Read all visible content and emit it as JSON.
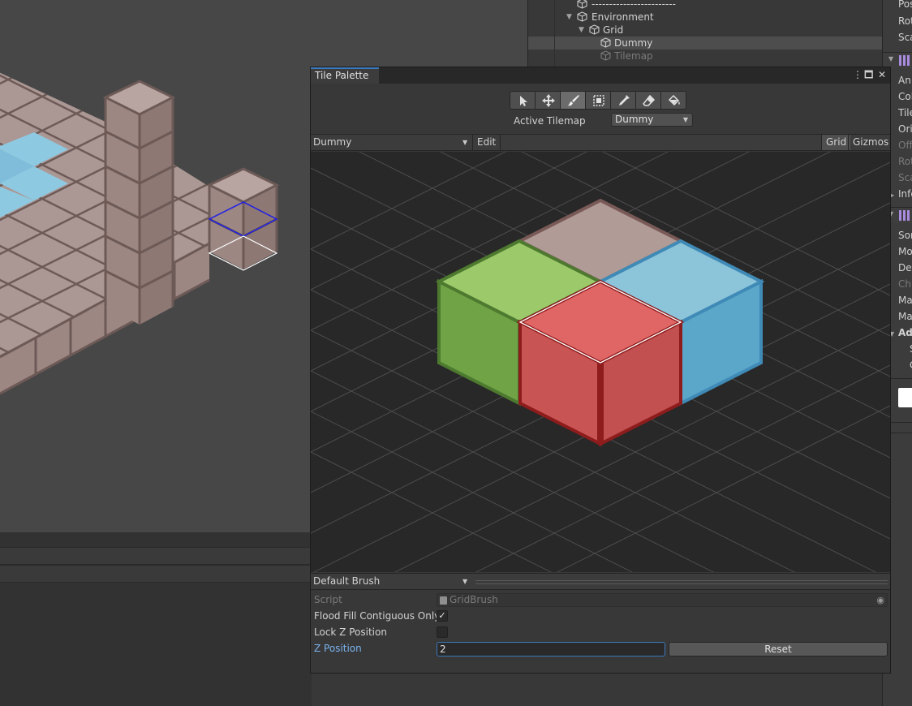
{
  "hierarchy": {
    "items": [
      {
        "label": "------------------------",
        "indent": 0,
        "state": "normal"
      },
      {
        "label": "Environment",
        "indent": 1,
        "state": "expanded"
      },
      {
        "label": "Grid",
        "indent": 2,
        "state": "expanded"
      },
      {
        "label": "Dummy",
        "indent": 3,
        "state": "selected"
      },
      {
        "label": "Tilemap",
        "indent": 3,
        "state": "dimmed"
      }
    ]
  },
  "inspector": {
    "labels": [
      "Pos",
      "Rot",
      "Sca",
      "Ani",
      "Col",
      "Tile",
      "Orie",
      "Off",
      "Rot",
      "Sca",
      "Info",
      "Sor",
      "Mo",
      "Det",
      "Chu",
      "Ma",
      "Ma",
      "Ad",
      "S",
      "C"
    ],
    "dimmed": [
      7,
      8,
      9,
      14
    ]
  },
  "tile_palette": {
    "tab_title": "Tile Palette",
    "tools": [
      {
        "name": "select-tool",
        "active": false
      },
      {
        "name": "move-tool",
        "active": false
      },
      {
        "name": "paint-tool",
        "active": true
      },
      {
        "name": "box-fill-tool",
        "active": false
      },
      {
        "name": "picker-tool",
        "active": false
      },
      {
        "name": "erase-tool",
        "active": false
      },
      {
        "name": "flood-fill-tool",
        "active": false
      }
    ],
    "active_tilemap_label": "Active Tilemap",
    "active_tilemap_value": "Dummy",
    "palette_select": "Dummy",
    "edit_label": "Edit",
    "grid_label": "Grid",
    "gizmos_label": "Gizmos",
    "brush_select": "Default Brush",
    "props": {
      "script_label": "Script",
      "script_value": "GridBrush",
      "flood_label": "Flood Fill Contiguous Only",
      "flood_checked": true,
      "lock_z_label": "Lock Z Position",
      "lock_z_checked": false,
      "z_label": "Z Position",
      "z_value": "2",
      "reset_label": "Reset"
    }
  },
  "colors": {
    "accent": "#3a79bb",
    "tile_gray": "#b09b97",
    "tile_green": "#9cca6b",
    "tile_blue": "#8cc5da",
    "tile_red": "#e06565",
    "scene_tile": "#ab9793",
    "scene_water": "#8ec9e2"
  }
}
